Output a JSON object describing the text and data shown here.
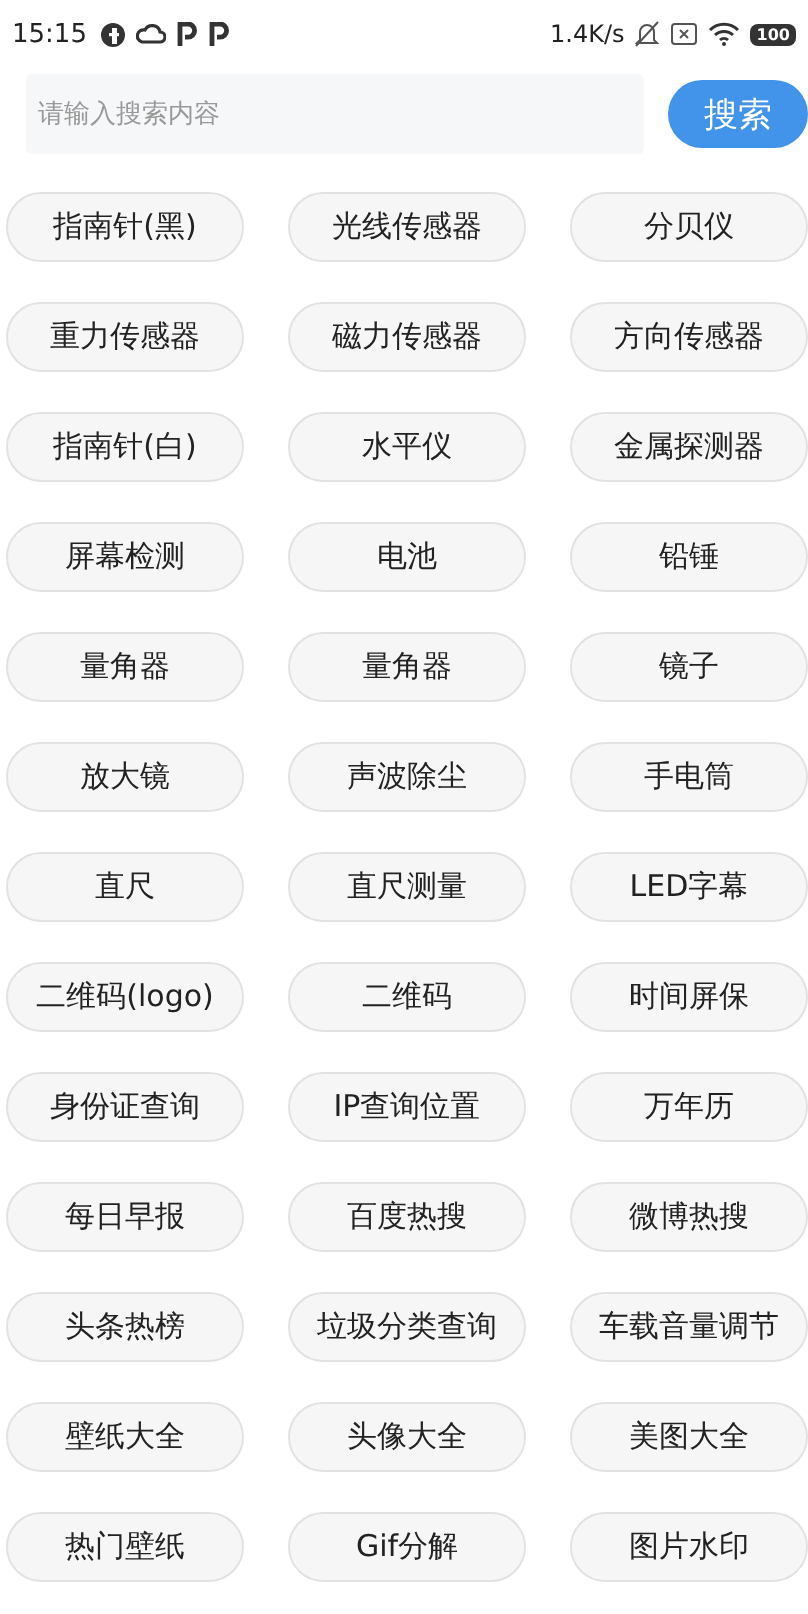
{
  "status_bar": {
    "time": "15:15",
    "speed": "1.4K/s",
    "battery": "100"
  },
  "search": {
    "placeholder": "请输入搜索内容",
    "button": "搜索"
  },
  "tools": [
    "指南针(黑)",
    "光线传感器",
    "分贝仪",
    "重力传感器",
    "磁力传感器",
    "方向传感器",
    "指南针(白)",
    "水平仪",
    "金属探测器",
    "屏幕检测",
    "电池",
    "铅锤",
    "量角器",
    "量角器",
    "镜子",
    "放大镜",
    "声波除尘",
    "手电筒",
    "直尺",
    "直尺测量",
    "LED字幕",
    "二维码(logo)",
    "二维码",
    "时间屏保",
    "身份证查询",
    "IP查询位置",
    "万年历",
    "每日早报",
    "百度热搜",
    "微博热搜",
    "头条热榜",
    "垃圾分类查询",
    "车载音量调节",
    "壁纸大全",
    "头像大全",
    "美图大全",
    "热门壁纸",
    "Gif分解",
    "图片水印"
  ]
}
